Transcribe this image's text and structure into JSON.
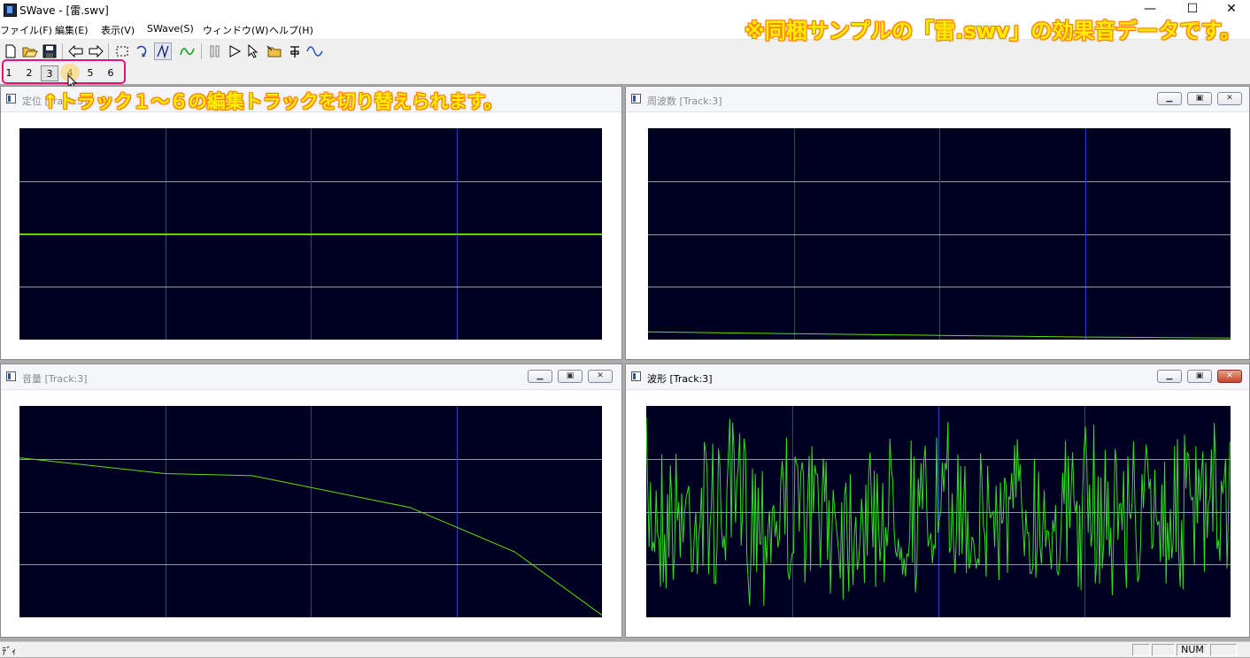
{
  "window": {
    "title": "SWave - [雷.swv]",
    "minimize": "—",
    "maximize": "☐",
    "close": "✕"
  },
  "menu": [
    "ファイル(F)",
    "編集(E)",
    "表示(V)",
    "SWave(S)",
    "ウィンドウ(W)",
    "ヘルプ(H)"
  ],
  "toolbar_icons": [
    "new-file-icon",
    "open-folder-icon",
    "save-icon",
    "undo-arrow-icon",
    "redo-arrow-icon",
    "select-rect-icon",
    "rotate-icon",
    "line-draw-icon",
    "wave-draw-icon",
    "pause-icon",
    "play-icon",
    "pointer-icon",
    "insert-icon",
    "marker-icon",
    "sine-icon"
  ],
  "tracks": {
    "labels": [
      "1",
      "2",
      "3",
      "4",
      "5",
      "6"
    ],
    "hover": "4"
  },
  "annotations": {
    "top": "※同梱サンプルの「雷.swv」の効果音データです。",
    "track": "↑トラック１～６の編集トラックを切り替えられます。"
  },
  "windows": {
    "pan": {
      "caption": "定位 [Track:3]"
    },
    "frequency": {
      "caption": "周波数 [Track:3]"
    },
    "volume": {
      "caption": "音量 [Track:3]"
    },
    "waveform": {
      "caption": "波形 [Track:3]"
    }
  },
  "statusbar": {
    "left": "ﾃﾞｨ",
    "num": "NUM"
  },
  "colors": {
    "plot_bg": "#000020",
    "trace": "#66dd00",
    "wave": "#33dd22",
    "grid_v": "#1e3cc8",
    "grid_h": "#c8c8dc",
    "annot_fill": "#ffee00",
    "annot_outline": "#ff7a00",
    "highlight": "#e8117a"
  },
  "curves": {
    "pan": [
      [
        0,
        0.5
      ],
      [
        1,
        0.5
      ]
    ],
    "frequency": [
      [
        0,
        0.963
      ],
      [
        0.25,
        0.972
      ],
      [
        0.5,
        0.98
      ],
      [
        0.75,
        0.988
      ],
      [
        1,
        0.993
      ]
    ],
    "volume": [
      [
        0,
        0.245
      ],
      [
        0.25,
        0.32
      ],
      [
        0.4,
        0.33
      ],
      [
        0.67,
        0.48
      ],
      [
        0.85,
        0.69
      ],
      [
        1,
        0.99
      ]
    ]
  }
}
